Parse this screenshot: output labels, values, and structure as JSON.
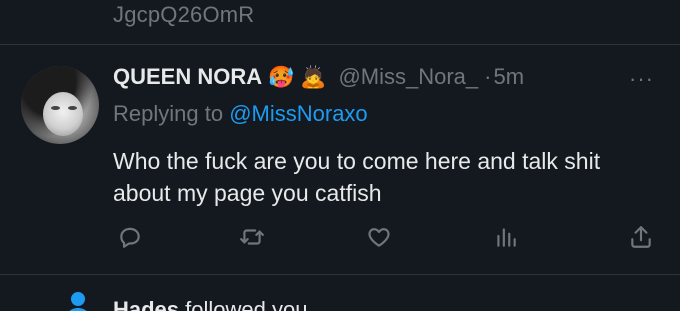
{
  "previous_tweet": {
    "text_tail": "JgcpQ26OmR"
  },
  "tweet": {
    "display_name": "QUEEN NORA",
    "emojis": [
      "🥵",
      "🙇"
    ],
    "handle": "@Miss_Nora_",
    "separator": "·",
    "time": "5m",
    "more": "···",
    "replying_prefix": "Replying to",
    "replying_to": "@MissNoraxo",
    "text": "Who the fuck are you to come here and talk shit about my page you catfish",
    "actions": [
      "reply-icon",
      "retweet-icon",
      "like-icon",
      "analytics-icon",
      "share-icon"
    ]
  },
  "next_notification": {
    "name": "Hades",
    "text": "followed you",
    "icon": "person-icon"
  },
  "colors": {
    "background": "#14191f",
    "text": "#e7e9ea",
    "muted": "#71767b",
    "accent": "#1d9bf0",
    "divider": "#2f3336"
  }
}
